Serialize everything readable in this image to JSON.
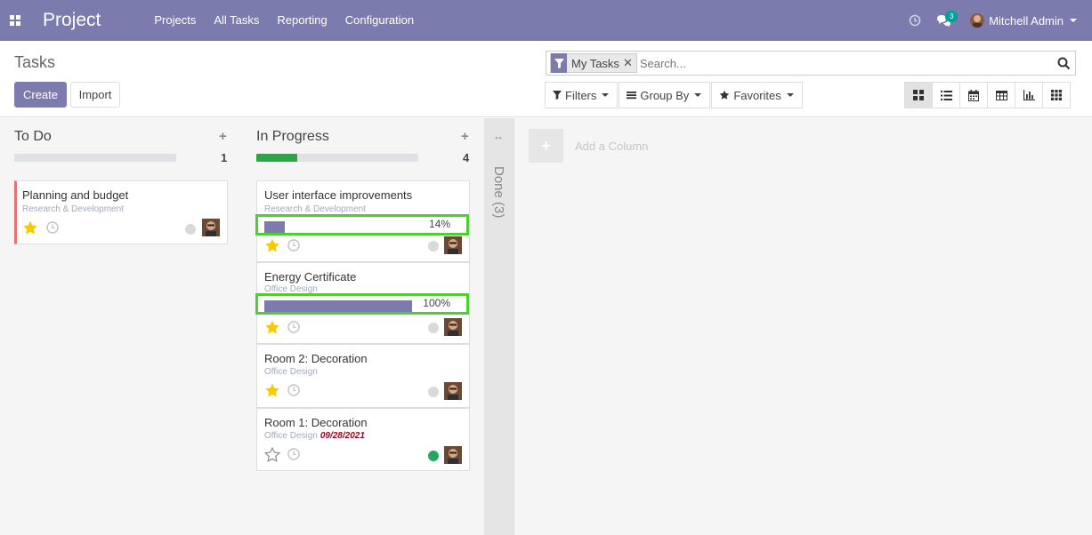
{
  "navbar": {
    "app_name": "Project",
    "menu": [
      "Projects",
      "All Tasks",
      "Reporting",
      "Configuration"
    ],
    "messages_count": "3",
    "user_name": "Mitchell Admin",
    "bg_color": "#7c7bad"
  },
  "control_panel": {
    "title": "Tasks",
    "create_label": "Create",
    "import_label": "Import",
    "search": {
      "facet_label": "My Tasks",
      "placeholder": "Search..."
    },
    "filters_label": "Filters",
    "group_by_label": "Group By",
    "favorites_label": "Favorites",
    "views": [
      "kanban",
      "list",
      "calendar",
      "pivot",
      "graph",
      "activity"
    ],
    "active_view": "kanban"
  },
  "kanban": {
    "columns": [
      {
        "title": "To Do",
        "count": "1",
        "progress": 0,
        "cards": [
          {
            "title": "Planning and budget",
            "project": "Research & Development",
            "starred": true,
            "status": "normal",
            "deadline": ""
          }
        ]
      },
      {
        "title": "In Progress",
        "count": "4",
        "progress": 0.25,
        "cards": [
          {
            "title": "User interface improvements",
            "project": "Research & Development",
            "starred": true,
            "status": "normal",
            "progress_label": "14%",
            "progress_value": 0.14,
            "deadline": ""
          },
          {
            "title": "Energy Certificate",
            "project": "Office Design",
            "starred": true,
            "status": "normal",
            "progress_label": "100%",
            "progress_value": 1.0,
            "deadline": ""
          },
          {
            "title": "Room 2: Decoration",
            "project": "Office Design",
            "starred": true,
            "status": "normal",
            "deadline": ""
          },
          {
            "title": "Room 1: Decoration",
            "project": "Office Design",
            "starred": false,
            "status": "done",
            "deadline": "09/28/2021"
          }
        ]
      }
    ],
    "folded_column": {
      "title": "Done (3)"
    },
    "add_column_label": "Add a Column"
  },
  "colors": {
    "accent": "#7c7bad",
    "progress_green": "#28a745",
    "highlight_green": "#4ccf2f",
    "star_yellow": "#f3cc00",
    "status_done": "#21a85f",
    "deadline_red": "#a5001b"
  }
}
